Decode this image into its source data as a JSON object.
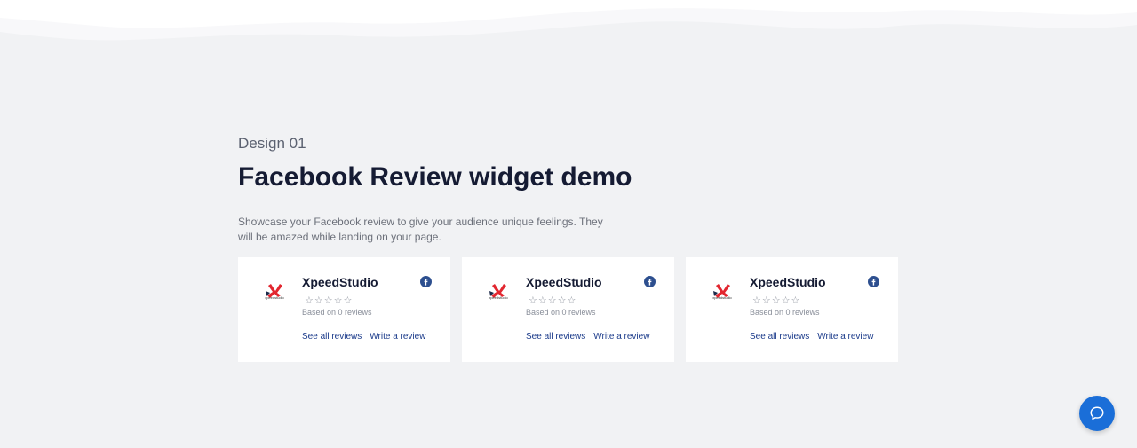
{
  "section": {
    "kicker": "Design 01",
    "title": "Facebook Review widget demo",
    "description": "Showcase your Facebook review to give your audience unique feelings. They will be amazed while landing on your page."
  },
  "cards": [
    {
      "name": "XpeedStudio",
      "logo_text": "xpeedstudio",
      "rating_stars": 0,
      "based_on": "Based on 0 reviews",
      "see_all": "See all reviews",
      "write": "Write a review"
    },
    {
      "name": "XpeedStudio",
      "logo_text": "xpeedstudio",
      "rating_stars": 0,
      "based_on": "Based on 0 reviews",
      "see_all": "See all reviews",
      "write": "Write a review"
    },
    {
      "name": "XpeedStudio",
      "logo_text": "xpeedstudio",
      "rating_stars": 0,
      "based_on": "Based on 0 reviews",
      "see_all": "See all reviews",
      "write": "Write a review"
    }
  ],
  "icons": {
    "facebook": "facebook-icon",
    "chat": "chat-bubble-icon",
    "star": "star-outline-icon"
  },
  "colors": {
    "background": "#f1f2f4",
    "title": "#151b33",
    "link": "#1a3a8a",
    "facebook": "#2d4f8f",
    "chat_button": "#1a6ed8",
    "logo_red": "#e2262f"
  }
}
